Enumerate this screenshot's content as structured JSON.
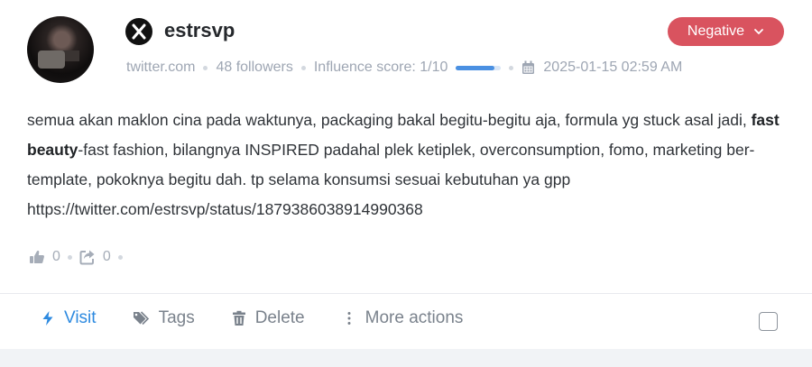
{
  "post": {
    "author": "estrsvp",
    "platform_icon": "x-logo-icon",
    "sentiment": "Negative",
    "meta": {
      "source": "twitter.com",
      "followers": "48 followers",
      "influence": "Influence score: 1/10",
      "influence_fraction": 0.1,
      "datetime": "2025-01-15 02:59 AM"
    },
    "body": {
      "before": "semua akan maklon cina pada waktunya, packaging bakal begitu-begitu aja, formula yg stuck asal jadi, ",
      "highlight": "fast beauty",
      "after": "-fast fashion, bilangnya INSPIRED padahal plek ketiplek, overconsumption, fomo, marketing ber-template, pokoknya begitu dah. tp selama konsumsi sesuai kebutuhan ya gpp https://twitter.com/estrsvp/status/1879386038914990368"
    },
    "engagement": {
      "likes": "0",
      "shares": "0"
    }
  },
  "actions": {
    "visit": "Visit",
    "tags": "Tags",
    "delete": "Delete",
    "more": "More actions"
  },
  "colors": {
    "negative": "#d9535f",
    "accent": "#2d8ae0"
  }
}
